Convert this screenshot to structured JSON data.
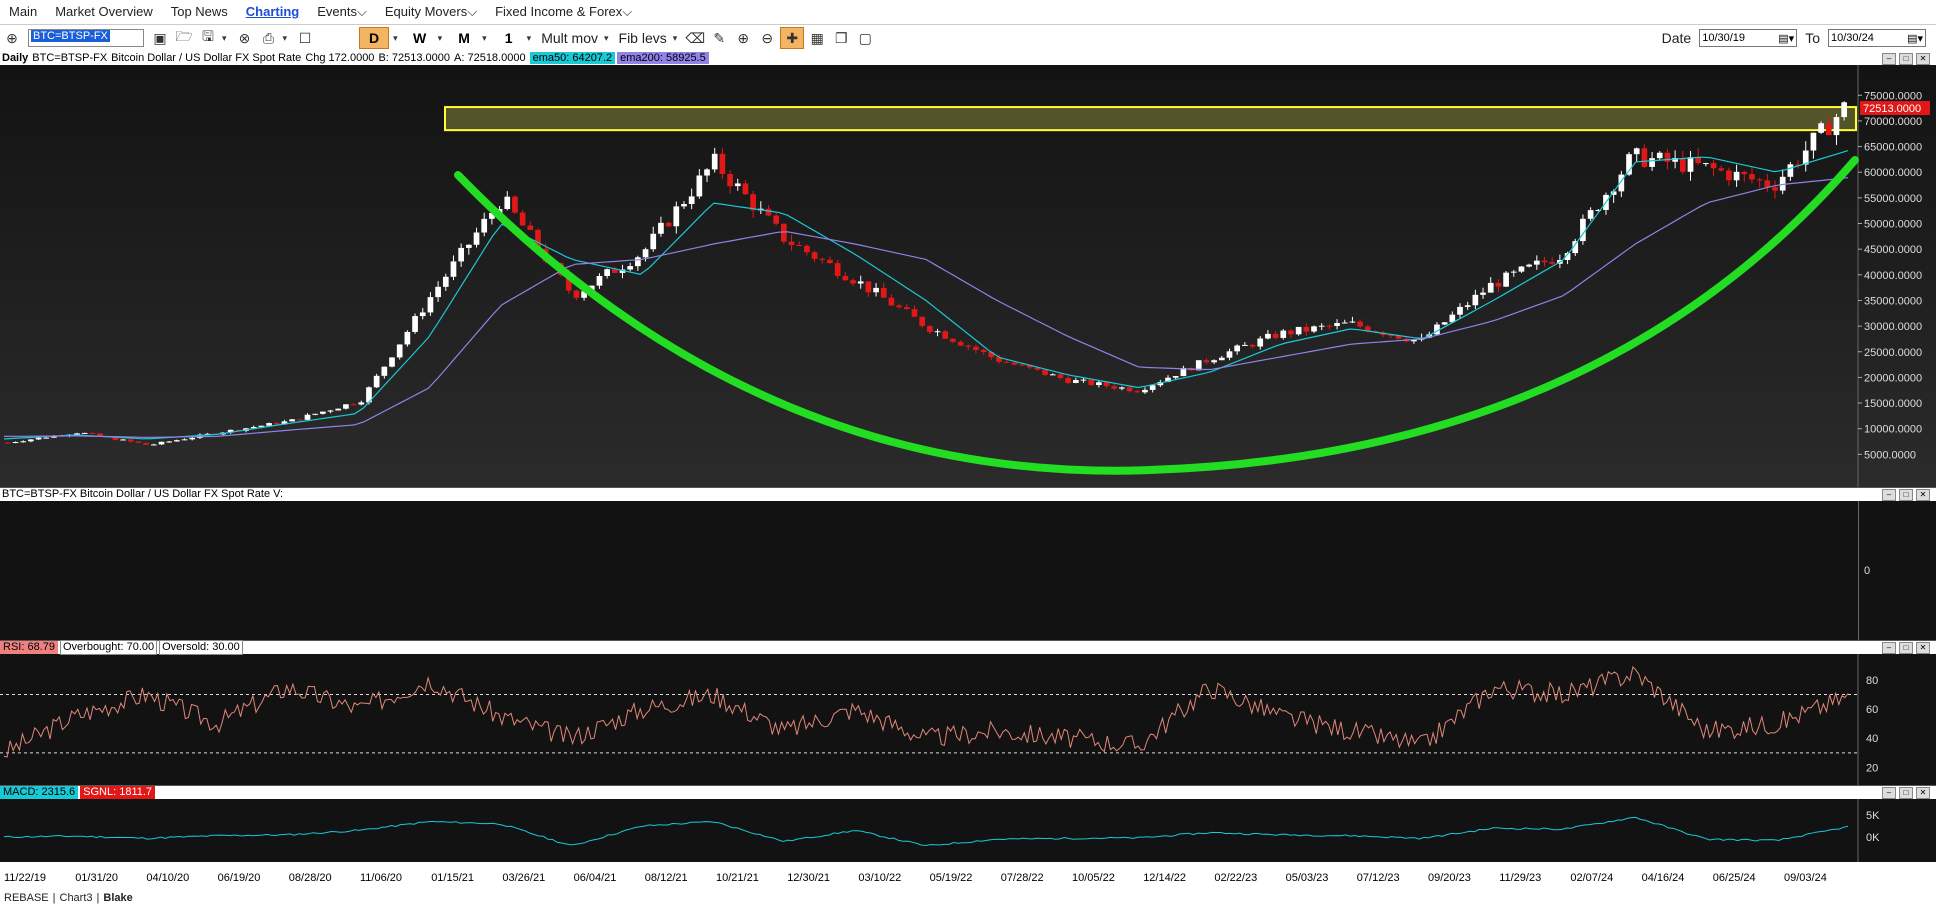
{
  "menu": {
    "items": [
      {
        "label": "Main",
        "active": false
      },
      {
        "label": "Market Overview",
        "active": false
      },
      {
        "label": "Top News",
        "active": false
      },
      {
        "label": "Charting",
        "active": true
      },
      {
        "label": "Events",
        "active": false
      },
      {
        "label": "Equity Movers",
        "active": false
      },
      {
        "label": "Fixed Income & Forex",
        "active": false
      }
    ]
  },
  "toolbar": {
    "symbol": "BTC=BTSP-FX",
    "period_d": "D",
    "period_w": "W",
    "period_m": "M",
    "period_1": "1",
    "mult_mov": "Mult mov",
    "fib_levs": "Fib levs",
    "date_label": "Date",
    "date_from": "10/30/19",
    "to_label": "To",
    "date_to": "10/30/24"
  },
  "price_pane": {
    "interval": "Daily",
    "instrument": "BTC=BTSP-FX",
    "description": "Bitcoin Dollar / US Dollar FX Spot Rate",
    "change": "Chg 172.0000",
    "bid": "B: 72513.0000",
    "ask": "A: 72518.0000",
    "ema50": "ema50: 64207.2",
    "ema200": "ema200: 58925.5",
    "last_price_tag": "72513.0000",
    "y_ticks": [
      "75000.0000",
      "70000.0000",
      "65000.0000",
      "60000.0000",
      "55000.0000",
      "50000.0000",
      "45000.0000",
      "40000.0000",
      "35000.0000",
      "30000.0000",
      "25000.0000",
      "20000.0000",
      "15000.0000",
      "10000.0000",
      "5000.0000"
    ],
    "colors": {
      "ema50": "#19c9d6",
      "ema200": "#8f83e8",
      "up": "#ffffff",
      "down": "#e01818",
      "zone": "#ffff33",
      "arc": "#22dd22"
    }
  },
  "volume_pane": {
    "title": "BTC=BTSP-FX  Bitcoin Dollar / US Dollar FX Spot Rate  V:",
    "y_tick": "0"
  },
  "rsi_pane": {
    "rsi": "RSI: 68.79",
    "overbought": "Overbought: 70.00",
    "oversold": "Oversold: 30.00",
    "y_ticks": [
      "80",
      "60",
      "40",
      "20"
    ]
  },
  "macd_pane": {
    "macd": "MACD: 2315.6",
    "signal": "SGNL: 1811.7",
    "y_ticks": [
      "5K",
      "0K"
    ]
  },
  "x_axis": {
    "labels": [
      "11/22/19",
      "01/31/20",
      "04/10/20",
      "06/19/20",
      "08/28/20",
      "11/06/20",
      "01/15/21",
      "03/26/21",
      "06/04/21",
      "08/12/21",
      "10/21/21",
      "12/30/21",
      "03/10/22",
      "05/19/22",
      "07/28/22",
      "10/05/22",
      "12/14/22",
      "02/22/23",
      "05/03/23",
      "07/12/23",
      "09/20/23",
      "11/29/23",
      "02/07/24",
      "04/16/24",
      "06/25/24",
      "09/03/24"
    ]
  },
  "footer": {
    "items": [
      "REBASE",
      "Chart3",
      "Blake"
    ]
  },
  "chart_data": {
    "type": "line",
    "title": "",
    "x": [
      "11/22/19",
      "01/31/20",
      "04/10/20",
      "06/19/20",
      "08/28/20",
      "11/06/20",
      "01/15/21",
      "03/26/21",
      "06/04/21",
      "08/12/21",
      "10/21/21",
      "12/30/21",
      "03/10/22",
      "05/19/22",
      "07/28/22",
      "10/05/22",
      "12/14/22",
      "02/22/23",
      "05/03/23",
      "07/12/23",
      "09/20/23",
      "11/29/23",
      "02/07/24",
      "04/16/24",
      "06/25/24",
      "09/03/24",
      "10/30/24"
    ],
    "series": [
      {
        "name": "BTC=BTSP-FX",
        "values": [
          7300,
          9300,
          6800,
          9300,
          11500,
          15500,
          36000,
          55000,
          36000,
          44500,
          62000,
          47000,
          39000,
          30000,
          23500,
          19500,
          17500,
          23500,
          28500,
          30500,
          27000,
          38000,
          44000,
          63000,
          61000,
          57500,
          72513
        ]
      },
      {
        "name": "ema50",
        "values": [
          8000,
          8800,
          8000,
          8900,
          11000,
          13000,
          28000,
          50000,
          43000,
          40000,
          54000,
          52000,
          44000,
          35000,
          24000,
          20500,
          18000,
          21000,
          26500,
          29500,
          27500,
          35000,
          43000,
          62000,
          63000,
          60000,
          64207
        ]
      },
      {
        "name": "ema200",
        "values": [
          8500,
          8600,
          8300,
          8500,
          9700,
          10800,
          18000,
          34000,
          42000,
          43000,
          46000,
          48500,
          46000,
          43000,
          35000,
          28000,
          22000,
          21500,
          24000,
          26500,
          27500,
          31000,
          36000,
          46000,
          54000,
          57500,
          58925
        ]
      }
    ],
    "ylim": [
      0,
      77000
    ],
    "grid": false,
    "rsi": {
      "values": [
        30,
        55,
        70,
        50,
        75,
        60,
        80,
        55,
        40,
        60,
        70,
        45,
        60,
        40,
        45,
        40,
        35,
        75,
        55,
        45,
        35,
        75,
        70,
        85,
        45,
        50,
        68.79
      ],
      "overbought": 70,
      "oversold": 30,
      "ylim": [
        10,
        95
      ]
    },
    "macd": {
      "values": [
        0,
        200,
        -300,
        300,
        500,
        1500,
        3500,
        3000,
        -2000,
        2500,
        3500,
        -1000,
        1500,
        -2000,
        -500,
        -300,
        -200,
        1000,
        500,
        300,
        -300,
        2000,
        1800,
        4500,
        -500,
        -800,
        2315.6
      ],
      "signal": 1811.7
    }
  }
}
